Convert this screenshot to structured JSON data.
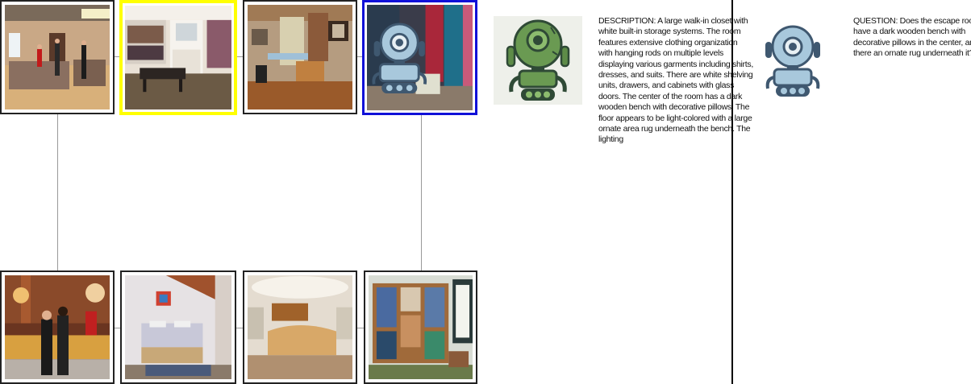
{
  "panel": {
    "description": "DESCRIPTION: A large walk-in closet with white built-in storage systems. The room features extensive clothing organization with hanging rods on multiple levels displaying various garments including shirts, dresses, and suits. There are white shelving units, drawers, and cabinets with glass doors. The center of the room has a dark wooden bench with decorative pillows. The floor appears to be light-colored with a large ornate area rug underneath the bench. The lighting",
    "question": "QUESTION: Does the escape room have a dark wooden bench with decorative pillows in the center, and is there an ornate rug underneath it?"
  },
  "thumbnails_top": [
    {
      "name": "hotel-lobby-reception",
      "highlight": "none"
    },
    {
      "name": "walk-in-closet",
      "highlight": "yellow"
    },
    {
      "name": "study-room",
      "highlight": "none"
    },
    {
      "name": "closet-with-robot-overlay",
      "highlight": "blue"
    }
  ],
  "thumbnails_bottom": [
    {
      "name": "reception-desk-staff",
      "highlight": "none"
    },
    {
      "name": "bedroom",
      "highlight": "none"
    },
    {
      "name": "reception-counter",
      "highlight": "none"
    },
    {
      "name": "closet-shelving",
      "highlight": "none"
    }
  ],
  "icons": [
    "robot-icon-green",
    "robot-icon-blue",
    "robot-icon-overlay"
  ],
  "colors": {
    "highlight_yellow": "#ffff00",
    "highlight_blue": "#1010d8",
    "connector": "#9a9a9a"
  }
}
